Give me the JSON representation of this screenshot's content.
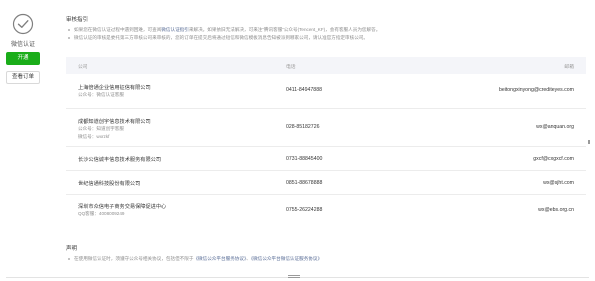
{
  "sidebar": {
    "verify_label": "微信认证",
    "open_button": "开通",
    "orders_button": "查看订单"
  },
  "guide": {
    "title": "审核指引",
    "bullets": [
      {
        "pre": "如果您在微信认证过程中遇到困难，可查阅",
        "link": "微信认证指引",
        "post": "来解决。如果依旧无法解决，可来注“腾讯客服”公众号(Tencent_KF)，会有客服人员为您解答。"
      },
      {
        "pre": "微信认证的审核是委托第三方审核公司来审核的，您的订单在提交后将通过短信和微信模板消息告知被派到哪家公司，请认准官方指定审核公司。",
        "link": "",
        "post": ""
      }
    ]
  },
  "table": {
    "headers": [
      "公司",
      "电话",
      "邮箱"
    ],
    "rows": [
      {
        "company": "上海倍通企业信用征信有限公司",
        "subs": [
          "公众号：微信认证客服"
        ],
        "phone": "0411-84947888",
        "email": "beitongxinyong@crediteyes.com"
      },
      {
        "company": "成都知道创宇信息技术有限公司",
        "subs": [
          "公众号：知道创宇客服",
          "微信号：wxrzkf"
        ],
        "phone": "028-85182726",
        "email": "wx@anquan.org"
      },
      {
        "company": "长沙公信诚丰信息技术服务有限公司",
        "subs": [],
        "phone": "0731-88845400",
        "email": "gxcf@cxgxcf.com"
      },
      {
        "company": "世纪信通科技股份有限公司",
        "subs": [],
        "phone": "0851-88678888",
        "email": "wx@sjht.com"
      },
      {
        "company": "深圳市众信电子商务交易保障促进中心",
        "subs": [
          "QQ客服：4008009249"
        ],
        "phone": "0755-26224288",
        "email": "wx@ebs.org.cn"
      }
    ]
  },
  "statement": {
    "title": "声明",
    "pre": "在使用微信认证时，须遵守公众号相关协议，包括但不限于",
    "link1": "《微信公众平台服务协议》",
    "mid": "、",
    "link2": "《微信公众平台微信认证服务协议》"
  }
}
